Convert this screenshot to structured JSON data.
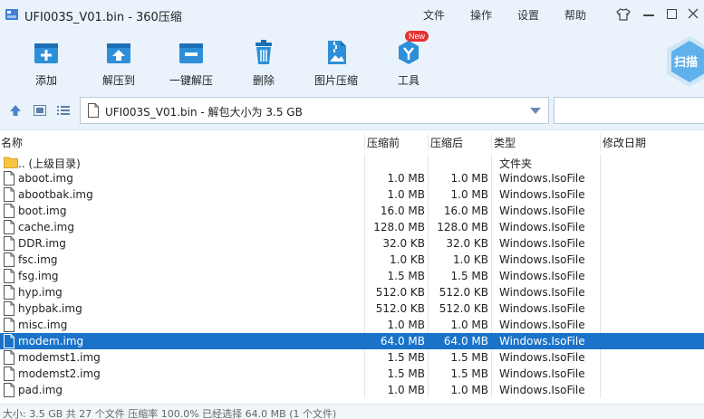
{
  "window": {
    "title": "UFI003S_V01.bin - 360压缩",
    "menus": [
      "文件",
      "操作",
      "设置",
      "帮助"
    ]
  },
  "toolbar": {
    "buttons": [
      {
        "label": "添加",
        "icon": "add-box-icon"
      },
      {
        "label": "解压到",
        "icon": "extract-to-icon"
      },
      {
        "label": "一键解压",
        "icon": "one-click-extract-icon"
      },
      {
        "label": "删除",
        "icon": "trash-icon"
      },
      {
        "label": "图片压缩",
        "icon": "image-compress-icon"
      },
      {
        "label": "工具",
        "icon": "tools-icon"
      }
    ],
    "new_badge": "New",
    "scan_label": "扫描"
  },
  "address": {
    "path": "UFI003S_V01.bin - 解包大小为 3.5 GB"
  },
  "columns": {
    "name": "名称",
    "before": "压缩前",
    "after": "压缩后",
    "type": "类型",
    "date": "修改日期"
  },
  "files": [
    {
      "name": ".. (上级目录)",
      "before": "",
      "after": "",
      "type": "文件夹",
      "date": "",
      "folder": true
    },
    {
      "name": "aboot.img",
      "before": "1.0 MB",
      "after": "1.0 MB",
      "type": "Windows.IsoFile",
      "date": ""
    },
    {
      "name": "abootbak.img",
      "before": "1.0 MB",
      "after": "1.0 MB",
      "type": "Windows.IsoFile",
      "date": ""
    },
    {
      "name": "boot.img",
      "before": "16.0 MB",
      "after": "16.0 MB",
      "type": "Windows.IsoFile",
      "date": ""
    },
    {
      "name": "cache.img",
      "before": "128.0 MB",
      "after": "128.0 MB",
      "type": "Windows.IsoFile",
      "date": ""
    },
    {
      "name": "DDR.img",
      "before": "32.0 KB",
      "after": "32.0 KB",
      "type": "Windows.IsoFile",
      "date": ""
    },
    {
      "name": "fsc.img",
      "before": "1.0 KB",
      "after": "1.0 KB",
      "type": "Windows.IsoFile",
      "date": ""
    },
    {
      "name": "fsg.img",
      "before": "1.5 MB",
      "after": "1.5 MB",
      "type": "Windows.IsoFile",
      "date": ""
    },
    {
      "name": "hyp.img",
      "before": "512.0 KB",
      "after": "512.0 KB",
      "type": "Windows.IsoFile",
      "date": ""
    },
    {
      "name": "hypbak.img",
      "before": "512.0 KB",
      "after": "512.0 KB",
      "type": "Windows.IsoFile",
      "date": ""
    },
    {
      "name": "misc.img",
      "before": "1.0 MB",
      "after": "1.0 MB",
      "type": "Windows.IsoFile",
      "date": ""
    },
    {
      "name": "modem.img",
      "before": "64.0 MB",
      "after": "64.0 MB",
      "type": "Windows.IsoFile",
      "date": "",
      "selected": true
    },
    {
      "name": "modemst1.img",
      "before": "1.5 MB",
      "after": "1.5 MB",
      "type": "Windows.IsoFile",
      "date": ""
    },
    {
      "name": "modemst2.img",
      "before": "1.5 MB",
      "after": "1.5 MB",
      "type": "Windows.IsoFile",
      "date": ""
    },
    {
      "name": "pad.img",
      "before": "1.0 MB",
      "after": "1.0 MB",
      "type": "Windows.IsoFile",
      "date": ""
    }
  ],
  "status": {
    "text": "大小: 3.5 GB 共 27 个文件 压缩率 100.0% 已经选择 64.0 MB (1 个文件)"
  },
  "colors": {
    "chrome_bg": "#eaf3fb",
    "accent": "#1a73c9",
    "icon_blue": "#2d8fd8",
    "new_badge": "#e6322f"
  }
}
